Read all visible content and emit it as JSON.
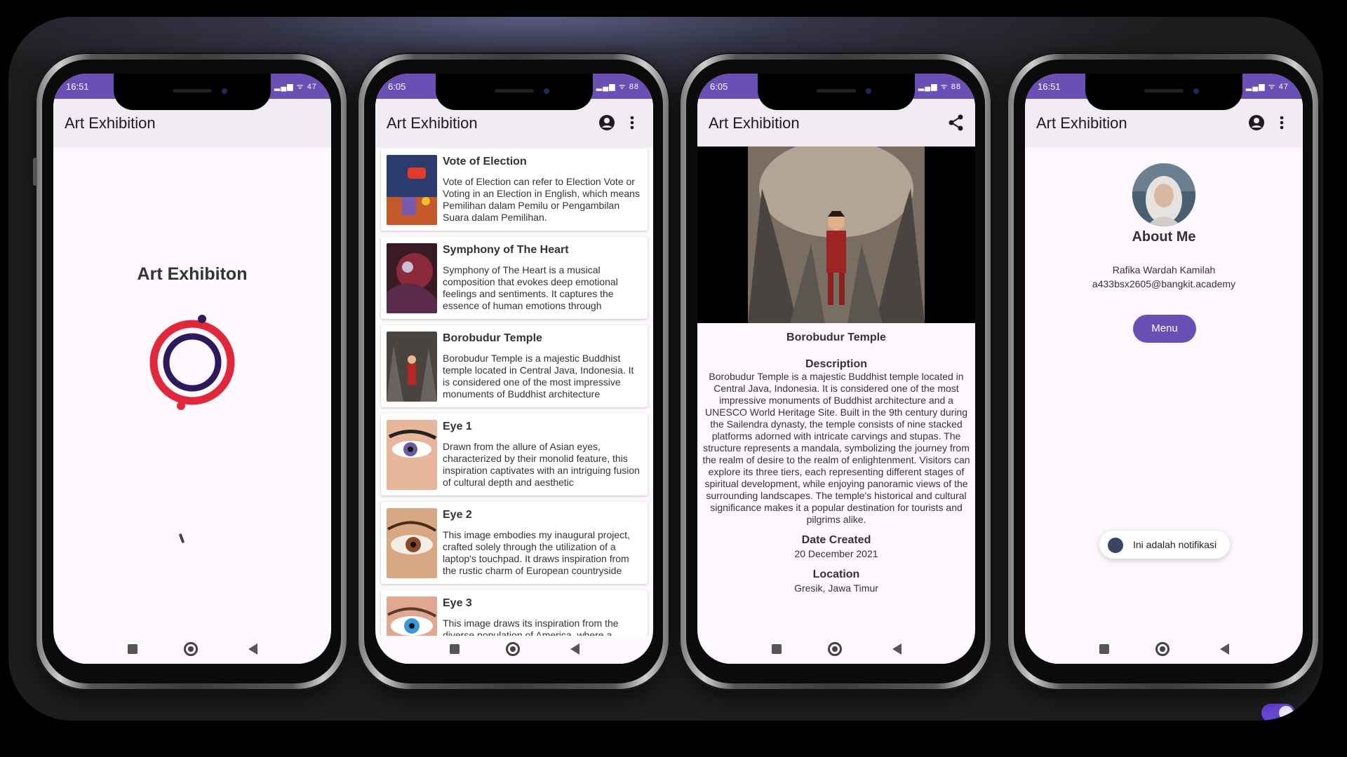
{
  "app": {
    "title": "Art Exhibition"
  },
  "colors": {
    "primary": "#6a4fb4",
    "appbar": "#f1ebf3",
    "logo_red": "#e0283a",
    "logo_navy": "#2e1a5a"
  },
  "phones": [
    {
      "time": "16:51",
      "battery": "47"
    },
    {
      "time": "6:05",
      "battery": "88"
    },
    {
      "time": "6:05",
      "battery": "88"
    },
    {
      "time": "16:51",
      "battery": "47"
    }
  ],
  "icons": {
    "account": "account-circle-icon",
    "more": "more-vert-icon",
    "share": "share-icon"
  },
  "splash": {
    "title": "Art Exhibiton"
  },
  "list": {
    "items": [
      {
        "title": "Vote of Election",
        "desc": "Vote of Election can refer to Election Vote or Voting in an Election in English, which means Pemilihan dalam Pemilu or Pengambilan Suara dalam Pemilihan."
      },
      {
        "title": "Symphony of The Heart",
        "desc": "Symphony of The Heart is a musical composition that evokes deep emotional feelings and sentiments. It captures the essence of human emotions through"
      },
      {
        "title": "Borobudur Temple",
        "desc": "Borobudur Temple is a majestic Buddhist temple located in Central Java, Indonesia. It is considered one of the most impressive monuments of Buddhist architecture"
      },
      {
        "title": "Eye 1",
        "desc": "Drawn from the allure of Asian eyes, characterized by their monolid feature, this inspiration captivates with an intriguing fusion of cultural depth and aesthetic"
      },
      {
        "title": "Eye 2",
        "desc": "This image embodies my inaugural project, crafted solely through the utilization of a laptop's touchpad. It draws inspiration from the rustic charm of European countryside"
      },
      {
        "title": "Eye 3",
        "desc": "This image draws its inspiration from the diverse population of America, where a majority of individuals have eye colors ranging from blue to brown. It"
      }
    ]
  },
  "detail": {
    "name": "Borobudur Temple",
    "description_label": "Description",
    "description": "Borobudur Temple is a majestic Buddhist temple located in Central Java, Indonesia. It is considered one of the most impressive monuments of Buddhist architecture and a UNESCO World Heritage Site. Built in the 9th century during the Sailendra dynasty, the temple consists of nine stacked platforms adorned with intricate carvings and stupas. The structure represents a mandala, symbolizing the journey from the realm of desire to the realm of enlightenment. Visitors can explore its three tiers, each representing different stages of spiritual development, while enjoying panoramic views of the surrounding landscapes. The temple's historical and cultural significance makes it a popular destination for tourists and pilgrims alike.",
    "date_label": "Date Created",
    "date": "20 December 2021",
    "location_label": "Location",
    "location": "Gresik, Jawa Timur"
  },
  "about": {
    "title": "About Me",
    "name": "Rafika Wardah Kamilah",
    "email": "a433bsx2605@bangkit.academy",
    "menu_label": "Menu",
    "toast": "Ini adalah notifikasi"
  }
}
